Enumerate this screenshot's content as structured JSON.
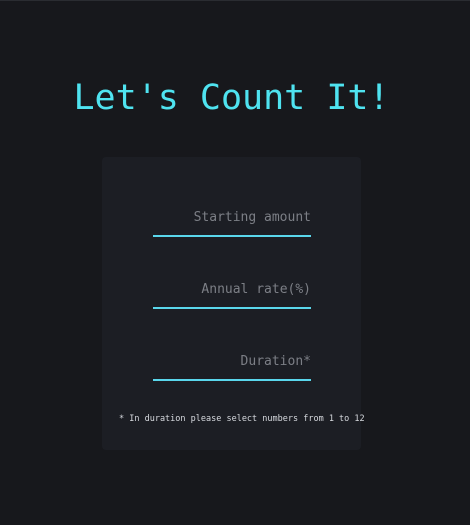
{
  "header": {
    "title": "Let's Count It!"
  },
  "form": {
    "starting_amount": {
      "placeholder": "Starting amount",
      "value": ""
    },
    "annual_rate": {
      "placeholder": "Annual rate(%)",
      "value": ""
    },
    "duration": {
      "placeholder": "Duration*",
      "value": ""
    },
    "note": "* In duration please select numbers from 1 to 12"
  },
  "colors": {
    "background": "#17181c",
    "card": "#1c1e24",
    "accent": "#4fe3f0",
    "underline": "#5ad7ec",
    "placeholder": "#7c7f86"
  }
}
